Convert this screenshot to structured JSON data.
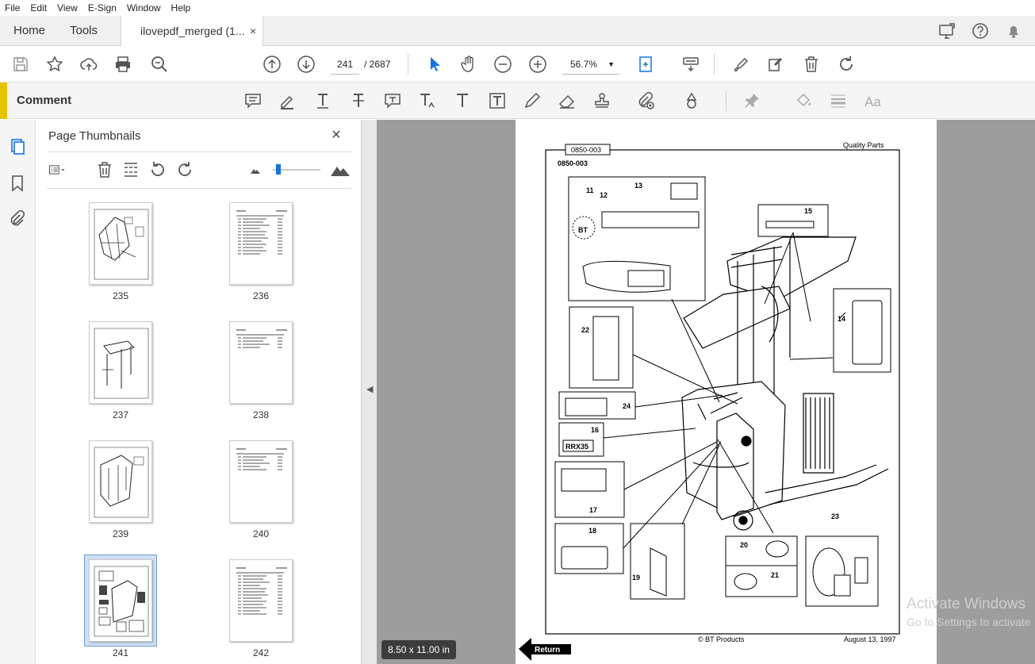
{
  "menu": [
    "File",
    "Edit",
    "View",
    "E-Sign",
    "Window",
    "Help"
  ],
  "tabs": {
    "home": "Home",
    "tools": "Tools",
    "document": "ilovepdf_merged (1...",
    "close": "×"
  },
  "toolbar": {
    "page_current": "241",
    "page_total": "/  2687",
    "zoom": "56.7%"
  },
  "comment": {
    "label": "Comment"
  },
  "panel": {
    "title": "Page Thumbnails",
    "close": "×",
    "thumbnails": [
      {
        "page": "235"
      },
      {
        "page": "236"
      },
      {
        "page": "237"
      },
      {
        "page": "238"
      },
      {
        "page": "239"
      },
      {
        "page": "240"
      },
      {
        "page": "241",
        "selected": true
      },
      {
        "page": "242"
      }
    ]
  },
  "document": {
    "header_box": "0850-003",
    "header_right": "Quality Parts",
    "subtitle": "0850-003",
    "callouts": [
      "11",
      "12",
      "13",
      "14",
      "15",
      "16",
      "17",
      "18",
      "19",
      "20",
      "21",
      "22",
      "23",
      "24"
    ],
    "label_rrx": "RRX35",
    "footer_center": "© BT Products",
    "footer_right": "August 13, 1997",
    "return_label": "Return",
    "page_size": "8.50 x 11.00 in"
  },
  "watermark": {
    "line1": "Activate Windows",
    "line2": "Go to Settings to activate"
  }
}
